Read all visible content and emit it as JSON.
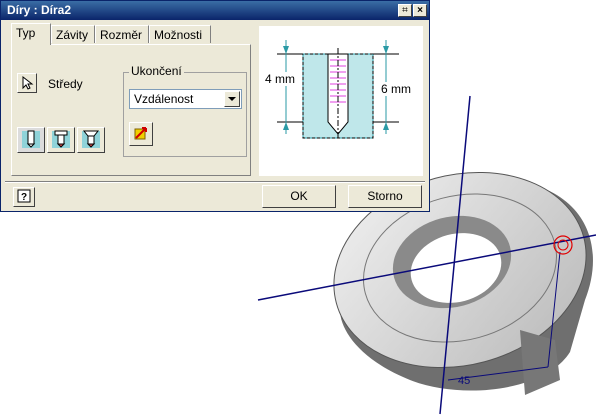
{
  "dialog": {
    "title": "Díry : Díra2",
    "buttons": {
      "pin_icon": "pin-icon",
      "close_icon": "close-icon"
    },
    "tabs": [
      {
        "label": "Typ",
        "active": true
      },
      {
        "label": "Závity",
        "active": false
      },
      {
        "label": "Rozměr",
        "active": false
      },
      {
        "label": "Možnosti",
        "active": false
      }
    ],
    "centers": {
      "label": "Středy",
      "icon": "cursor-select-icon"
    },
    "termination": {
      "group_label": "Ukončení",
      "selected": "Vzdálenost"
    },
    "preview": {
      "left_dim": "4 mm",
      "right_dim": "6 mm"
    },
    "footer": {
      "ok_label": "OK",
      "cancel_label": "Storno",
      "help_icon": "help-icon"
    }
  },
  "viewport": {
    "angle_label": "45",
    "axis_color": "#0a0a7a",
    "part_color": "#d8d8d8"
  }
}
